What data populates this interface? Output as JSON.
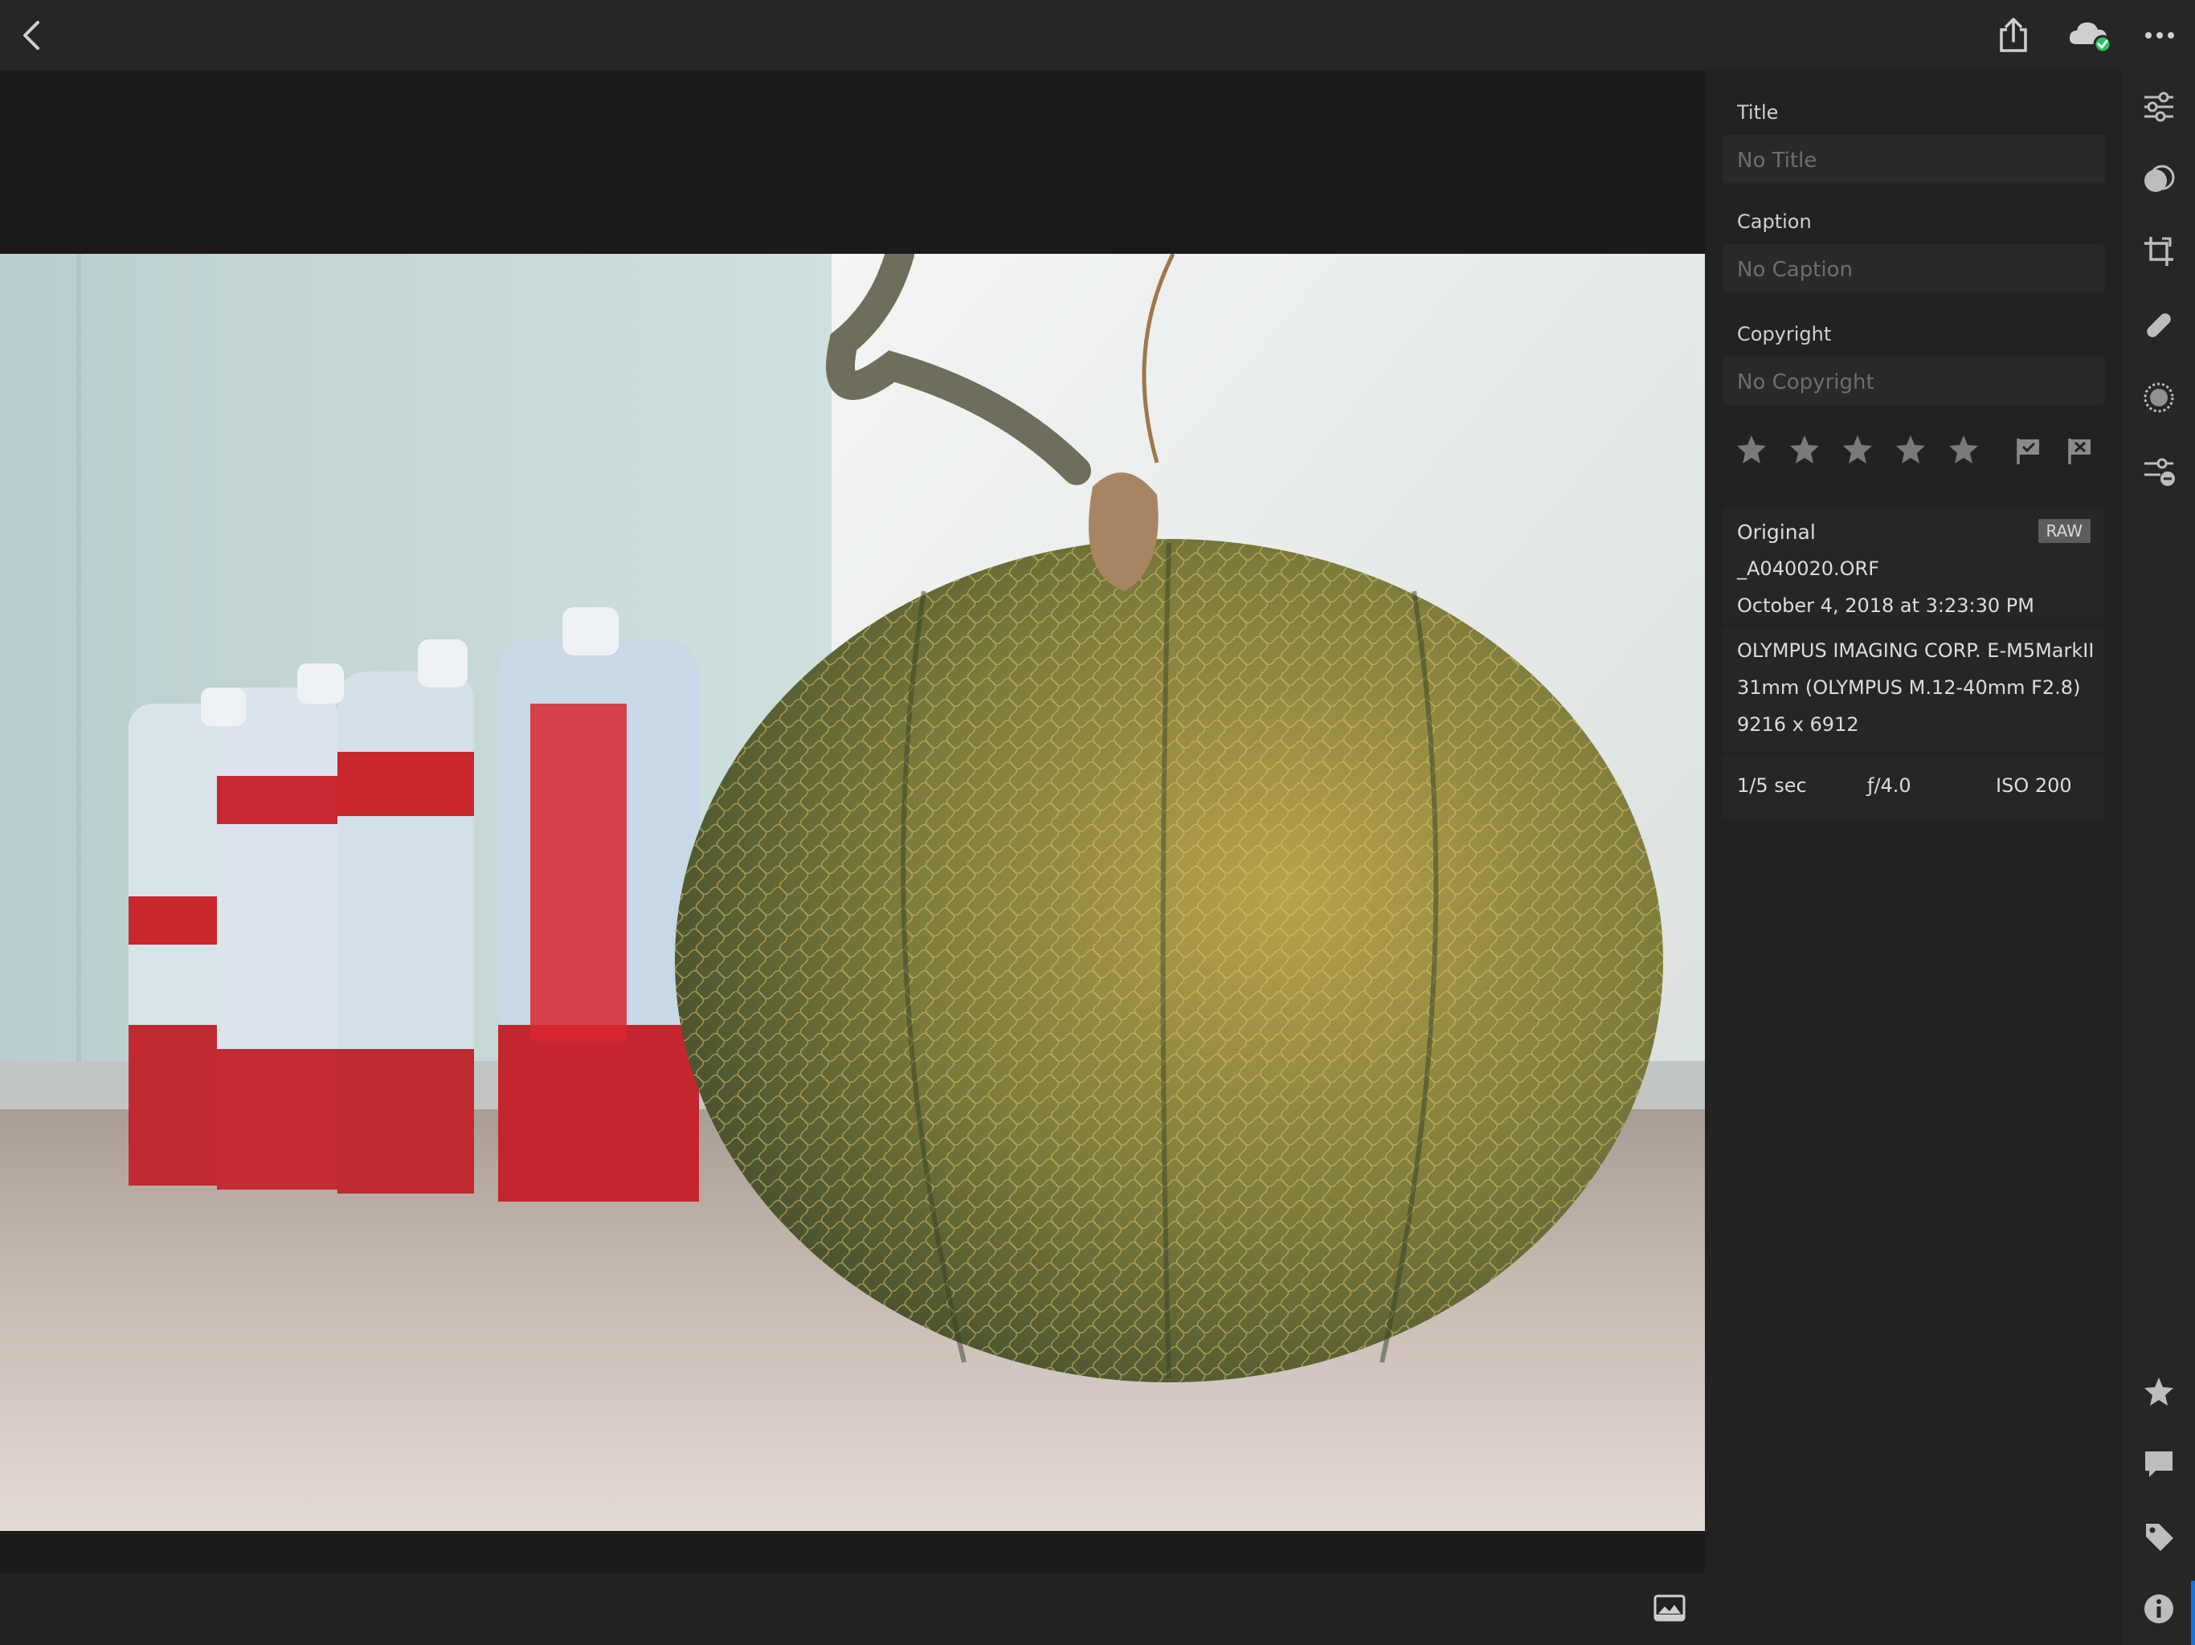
{
  "topbar": {
    "back_icon": "chevron-left-icon",
    "share_icon": "share-icon",
    "cloud_icon": "cloud-synced-icon",
    "more_icon": "more-icon"
  },
  "panel": {
    "title_label": "Title",
    "title_placeholder": "No Title",
    "caption_label": "Caption",
    "caption_placeholder": "No Caption",
    "copyright_label": "Copyright",
    "copyright_placeholder": "No Copyright",
    "rating": 0,
    "max_rating": 5,
    "file": {
      "heading": "Original",
      "badge": "RAW",
      "filename": "_A040020.ORF",
      "date": "October 4, 2018 at 3:23:30 PM"
    },
    "camera": {
      "body": "OLYMPUS IMAGING CORP.  E-M5MarkII",
      "lens": "31mm (OLYMPUS M.12-40mm F2.8)",
      "dimensions": "9216 x 6912"
    },
    "exposure": {
      "shutter": "1/5 sec",
      "aperture": "ƒ/4.0",
      "iso": "ISO 200"
    }
  },
  "tools": [
    "edit-sliders-icon",
    "presets-icon",
    "crop-icon",
    "healing-icon",
    "masking-icon",
    "versions-icon",
    "rate-review-icon",
    "comments-icon",
    "keywords-icon",
    "info-icon"
  ],
  "colors": {
    "accent": "#1473e6",
    "sync_ok": "#2dc163",
    "panel_bg": "#222222",
    "topbar_bg": "#262626"
  }
}
